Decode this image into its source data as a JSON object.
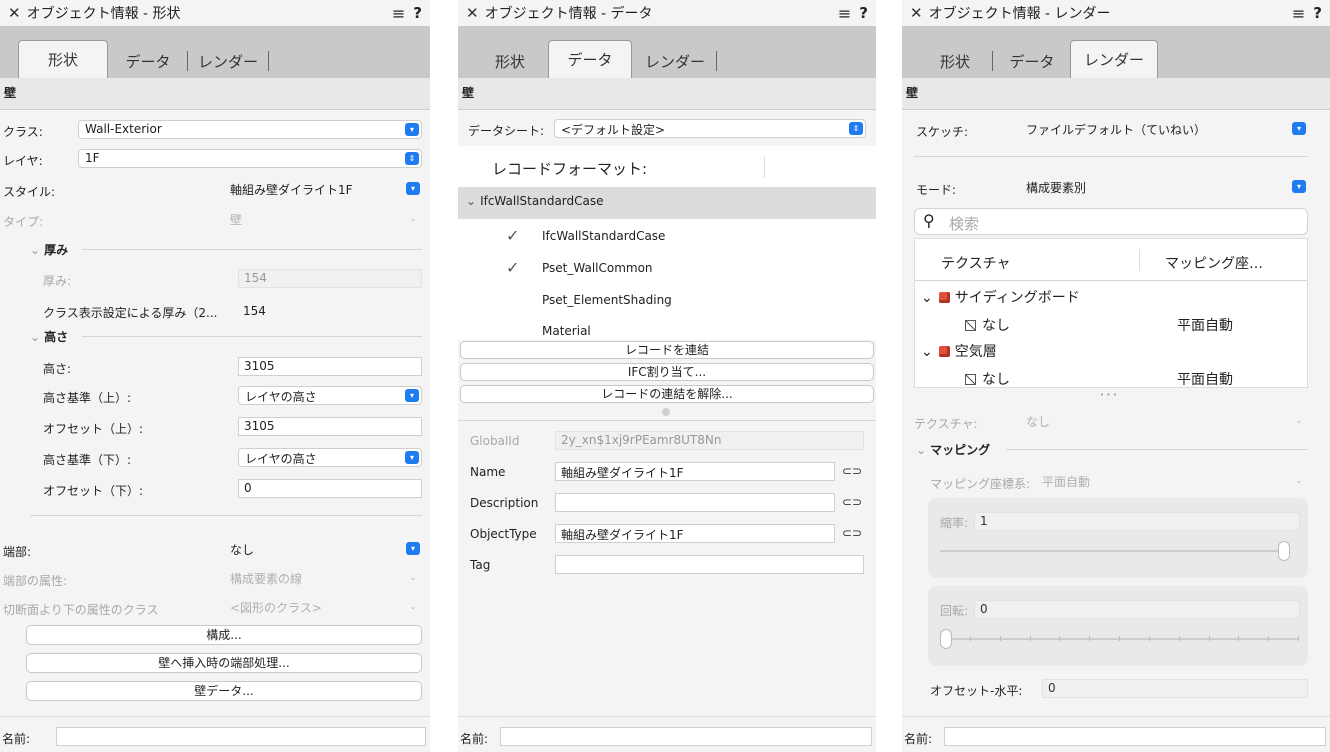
{
  "panel1": {
    "title": "オブジェクト情報 - 形状",
    "tabs": [
      "形状",
      "データ",
      "レンダー"
    ],
    "section": "壁",
    "class_label": "クラス:",
    "class_value": "Wall-Exterior",
    "layer_label": "レイヤ:",
    "layer_value": "1F",
    "style_label": "スタイル:",
    "style_value": "軸組み壁ダイライト1F",
    "type_label": "タイプ:",
    "type_value": "壁",
    "thickness_group": "厚み",
    "thickness_label": "厚み:",
    "thickness_value": "154",
    "class_thickness_label": "クラス表示設定による厚み（2...",
    "class_thickness_value": "154",
    "height_group": "高さ",
    "height_label": "高さ:",
    "height_value": "3105",
    "height_top_ref_label": "高さ基準（上）:",
    "height_top_ref_value": "レイヤの高さ",
    "offset_top_label": "オフセット（上）:",
    "offset_top_value": "3105",
    "height_bottom_ref_label": "高さ基準（下）:",
    "height_bottom_ref_value": "レイヤの高さ",
    "offset_bottom_label": "オフセット（下）:",
    "offset_bottom_value": "0",
    "end_label": "端部:",
    "end_value": "なし",
    "end_attr_label": "端部の属性:",
    "end_attr_value": "構成要素の線",
    "cut_class_label": "切断面より下の属性のクラス",
    "cut_class_value": "<図形のクラス>",
    "btn_compose": "構成...",
    "btn_end_insert": "壁へ挿入時の端部処理...",
    "btn_wall_data": "壁データ...",
    "name_label": "名前:"
  },
  "panel2": {
    "title": "オブジェクト情報 - データ",
    "tabs": [
      "形状",
      "データ",
      "レンダー"
    ],
    "section": "壁",
    "datasheet_label": "データシート:",
    "datasheet_value": "<デフォルト設定>",
    "record_format_header": "レコードフォーマット:",
    "ifc_group": "IfcWallStandardCase",
    "records": [
      "IfcWallStandardCase",
      "Pset_WallCommon",
      "Pset_ElementShading",
      "Material"
    ],
    "btn_link_record": "レコードを連結",
    "btn_ifc_assign": "IFC割り当て...",
    "btn_unlink_record": "レコードの連結を解除...",
    "globalid_label": "GlobalId",
    "globalid_value": "2y_xn$1xj9rPEamr8UT8Nn",
    "name_field_label": "Name",
    "name_field_value": "軸組み壁ダイライト1F",
    "description_label": "Description",
    "description_value": "",
    "objecttype_label": "ObjectType",
    "objecttype_value": "軸組み壁ダイライト1F",
    "tag_label": "Tag",
    "tag_value": "",
    "name_label": "名前:"
  },
  "panel3": {
    "title": "オブジェクト情報 - レンダー",
    "tabs": [
      "形状",
      "データ",
      "レンダー"
    ],
    "section": "壁",
    "sketch_label": "スケッチ:",
    "sketch_value": "ファイルデフォルト（ていねい）",
    "mode_label": "モード:",
    "mode_value": "構成要素別",
    "search_placeholder": "検索",
    "col_texture": "テクスチャ",
    "col_mapping": "マッピング座…",
    "tree": [
      {
        "name": "サイディングボード",
        "child": "なし",
        "mapping": "平面自動"
      },
      {
        "name": "空気層",
        "child": "なし",
        "mapping": "平面自動"
      }
    ],
    "more": "• • •",
    "texture_label": "テクスチャ:",
    "texture_value": "なし",
    "mapping_group": "マッピング",
    "mapping_coord_label": "マッピング座標系:",
    "mapping_coord_value": "平面自動",
    "scale_label": "縮率:",
    "scale_value": "1",
    "scale_slider": 1.0,
    "rotation_label": "回転:",
    "rotation_value": "0",
    "rotation_slider": 0.0,
    "offset_h_label": "オフセット-水平:",
    "offset_h_value": "0",
    "name_label": "名前:"
  }
}
